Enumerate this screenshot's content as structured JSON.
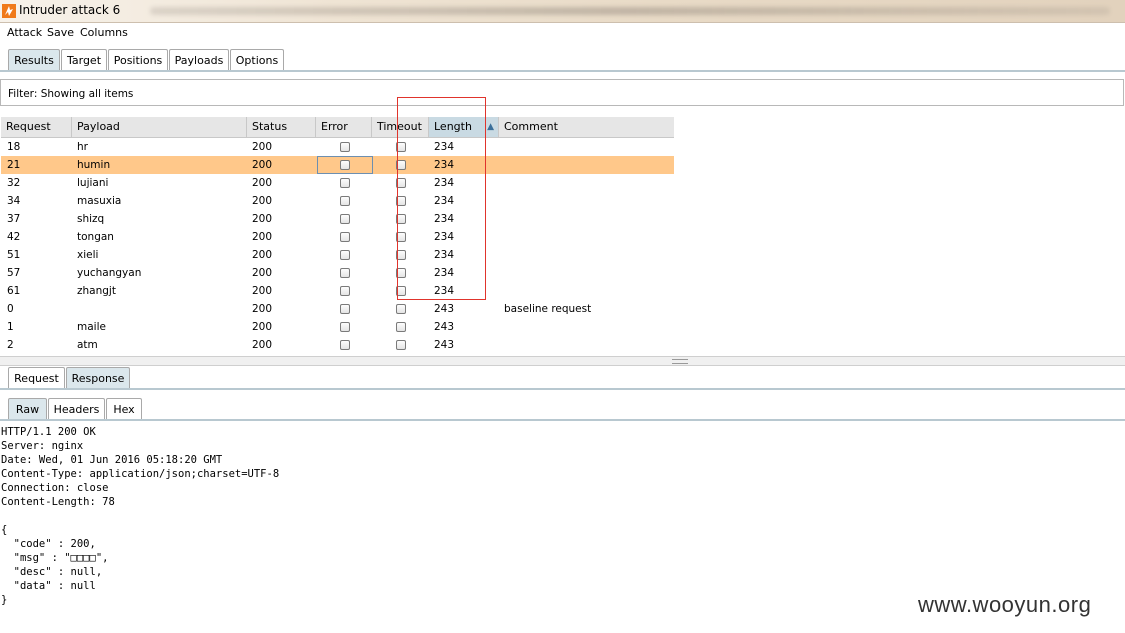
{
  "window": {
    "title": "Intruder attack 6"
  },
  "menu": [
    "Attack",
    "Save",
    "Columns"
  ],
  "main_tabs": [
    {
      "label": "Results",
      "active": true
    },
    {
      "label": "Target",
      "active": false
    },
    {
      "label": "Positions",
      "active": false
    },
    {
      "label": "Payloads",
      "active": false
    },
    {
      "label": "Options",
      "active": false
    }
  ],
  "filter": {
    "text": "Filter:  Showing all items"
  },
  "table": {
    "columns": [
      "Request",
      "Payload",
      "Status",
      "Error",
      "Timeout",
      "Length",
      "Comment"
    ],
    "sorted_column": "Length",
    "rows": [
      {
        "request": "18",
        "payload": "hr",
        "status": "200",
        "length": "234",
        "comment": "",
        "selected": false
      },
      {
        "request": "21",
        "payload": "humin",
        "status": "200",
        "length": "234",
        "comment": "",
        "selected": true
      },
      {
        "request": "32",
        "payload": "lujiani",
        "status": "200",
        "length": "234",
        "comment": "",
        "selected": false
      },
      {
        "request": "34",
        "payload": "masuxia",
        "status": "200",
        "length": "234",
        "comment": "",
        "selected": false
      },
      {
        "request": "37",
        "payload": "shizq",
        "status": "200",
        "length": "234",
        "comment": "",
        "selected": false
      },
      {
        "request": "42",
        "payload": "tongan",
        "status": "200",
        "length": "234",
        "comment": "",
        "selected": false
      },
      {
        "request": "51",
        "payload": "xieli",
        "status": "200",
        "length": "234",
        "comment": "",
        "selected": false
      },
      {
        "request": "57",
        "payload": "yuchangyan",
        "status": "200",
        "length": "234",
        "comment": "",
        "selected": false
      },
      {
        "request": "61",
        "payload": "zhangjt",
        "status": "200",
        "length": "234",
        "comment": "",
        "selected": false
      },
      {
        "request": "0",
        "payload": "",
        "status": "200",
        "length": "243",
        "comment": "baseline request",
        "selected": false
      },
      {
        "request": "1",
        "payload": "maile",
        "status": "200",
        "length": "243",
        "comment": "",
        "selected": false
      },
      {
        "request": "2",
        "payload": "atm",
        "status": "200",
        "length": "243",
        "comment": "",
        "selected": false
      }
    ]
  },
  "message_tabs": [
    {
      "label": "Request",
      "active": false
    },
    {
      "label": "Response",
      "active": true
    }
  ],
  "view_tabs": [
    {
      "label": "Raw",
      "active": true
    },
    {
      "label": "Headers",
      "active": false
    },
    {
      "label": "Hex",
      "active": false
    }
  ],
  "response_lines": [
    "HTTP/1.1 200 OK",
    "Server: nginx",
    "Date: Wed, 01 Jun 2016 05:18:20 GMT",
    "Content-Type: application/json;charset=UTF-8",
    "Connection: close",
    "Content-Length: 78",
    "",
    "{",
    "  \"code\" : 200,",
    "  \"msg\" : \"□□□□\",",
    "  \"desc\" : null,",
    "  \"data\" : null",
    "}"
  ],
  "watermark": "www.wooyun.org",
  "colors": {
    "selected_row": "#ffc88a",
    "active_tab": "#dbe7ec",
    "highlight_box": "#e0342c"
  }
}
